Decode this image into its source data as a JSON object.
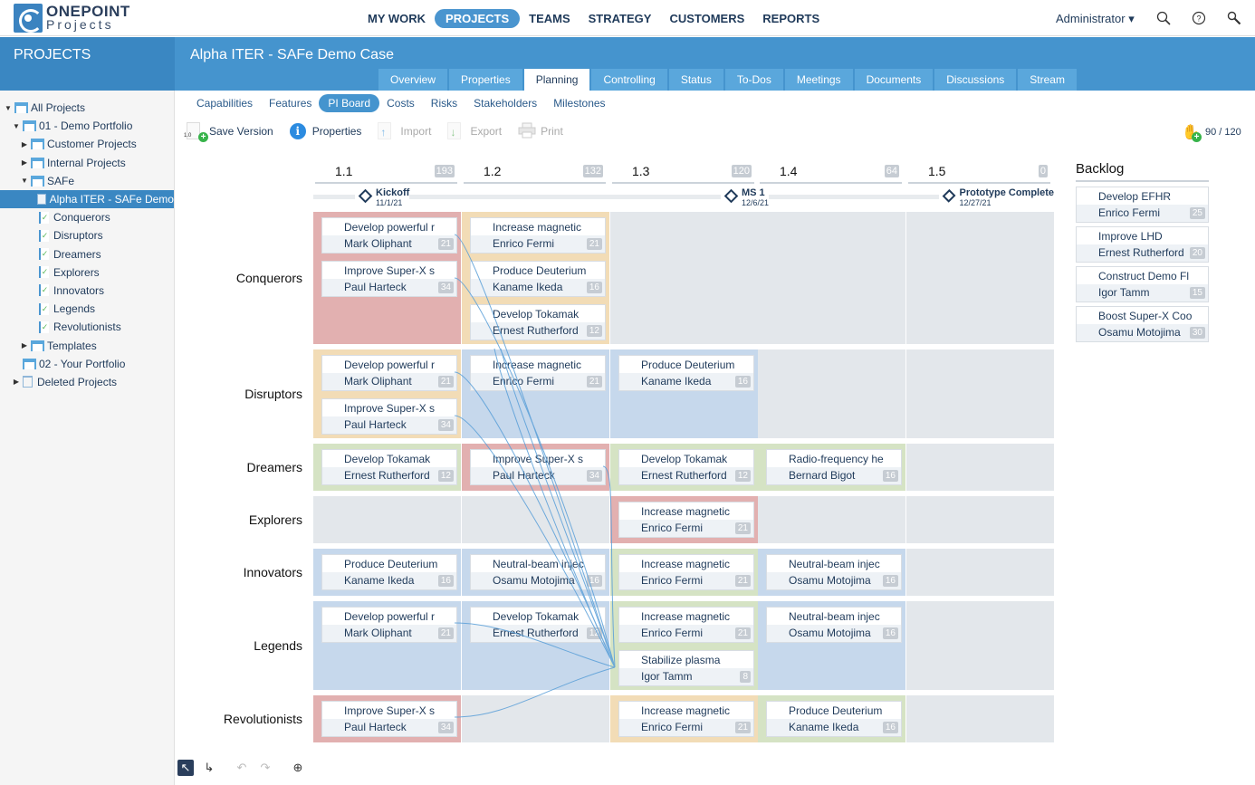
{
  "app": {
    "logo_top": "ONEPOINT",
    "logo_bottom": "Projects",
    "nav": [
      {
        "label": "MY WORK",
        "active": false
      },
      {
        "label": "PROJECTS",
        "active": true
      },
      {
        "label": "TEAMS",
        "active": false
      },
      {
        "label": "STRATEGY",
        "active": false
      },
      {
        "label": "CUSTOMERS",
        "active": false
      },
      {
        "label": "REPORTS",
        "active": false
      }
    ],
    "user": "Administrator ▾",
    "icons": {
      "search": "search-icon",
      "help": "help-icon",
      "tools": "wrench-icon"
    }
  },
  "sidebar": {
    "title": "PROJECTS",
    "tree": [
      {
        "label": "All Projects",
        "level": 0,
        "toggle": "▼",
        "icon": "folder"
      },
      {
        "label": "01 - Demo Portfolio",
        "level": 1,
        "toggle": "▼",
        "icon": "folder"
      },
      {
        "label": "Customer Projects",
        "level": 2,
        "toggle": "▶",
        "icon": "folder"
      },
      {
        "label": "Internal Projects",
        "level": 2,
        "toggle": "▶",
        "icon": "folder"
      },
      {
        "label": "SAFe",
        "level": 2,
        "toggle": "▼",
        "icon": "folder"
      },
      {
        "label": "Alpha ITER - SAFe Demo",
        "level": 3,
        "toggle": "",
        "icon": "project",
        "selected": true
      },
      {
        "label": "Conquerors",
        "level": 3,
        "toggle": "",
        "icon": "task"
      },
      {
        "label": "Disruptors",
        "level": 3,
        "toggle": "",
        "icon": "task"
      },
      {
        "label": "Dreamers",
        "level": 3,
        "toggle": "",
        "icon": "task"
      },
      {
        "label": "Explorers",
        "level": 3,
        "toggle": "",
        "icon": "task"
      },
      {
        "label": "Innovators",
        "level": 3,
        "toggle": "",
        "icon": "task"
      },
      {
        "label": "Legends",
        "level": 3,
        "toggle": "",
        "icon": "task"
      },
      {
        "label": "Revolutionists",
        "level": 3,
        "toggle": "",
        "icon": "task"
      },
      {
        "label": "Templates",
        "level": 2,
        "toggle": "▶",
        "icon": "folder"
      },
      {
        "label": "02 - Your Portfolio",
        "level": 1,
        "toggle": "",
        "icon": "folder"
      },
      {
        "label": "Deleted Projects",
        "level": 1,
        "toggle": "▶",
        "icon": "trash"
      }
    ]
  },
  "project": {
    "title": "Alpha ITER - SAFe Demo Case",
    "tabs": [
      {
        "label": "Overview"
      },
      {
        "label": "Properties"
      },
      {
        "label": "Planning",
        "active": true
      },
      {
        "label": "Controlling"
      },
      {
        "label": "Status"
      },
      {
        "label": "To-Dos"
      },
      {
        "label": "Meetings"
      },
      {
        "label": "Documents"
      },
      {
        "label": "Discussions"
      },
      {
        "label": "Stream"
      }
    ],
    "subtabs": [
      {
        "label": "Capabilities"
      },
      {
        "label": "Features"
      },
      {
        "label": "PI Board",
        "active": true
      },
      {
        "label": "Costs"
      },
      {
        "label": "Risks"
      },
      {
        "label": "Stakeholders"
      },
      {
        "label": "Milestones"
      }
    ],
    "toolbar": {
      "save_version": "Save Version",
      "properties": "Properties",
      "import": "Import",
      "export": "Export",
      "print": "Print",
      "version_badge": "1.0"
    },
    "capacity": "90 / 120"
  },
  "board": {
    "iterations": [
      {
        "label": "1.1",
        "count": "193"
      },
      {
        "label": "1.2",
        "count": "132"
      },
      {
        "label": "1.3",
        "count": "120"
      },
      {
        "label": "1.4",
        "count": "64"
      },
      {
        "label": "1.5",
        "count": "0"
      }
    ],
    "milestones": [
      {
        "name": "Kickoff",
        "date": "11/1/21"
      },
      {
        "name": "MS 1",
        "date": "12/6/21"
      },
      {
        "name": "Prototype Complete",
        "date": "12/27/21"
      }
    ],
    "teams": [
      {
        "name": "Conquerors",
        "cells": [
          {
            "color": "#e2b0b0",
            "cards": [
              {
                "title": "Develop powerful r",
                "owner": "Mark Oliphant",
                "points": "21"
              },
              {
                "title": "Improve Super-X s",
                "owner": "Paul Harteck",
                "points": "34"
              }
            ]
          },
          {
            "color": "#f2dcb6",
            "cards": [
              {
                "title": "Increase magnetic",
                "owner": "Enrico Fermi",
                "points": "21"
              },
              {
                "title": "Produce Deuterium",
                "owner": "Kaname Ikeda",
                "points": "16"
              },
              {
                "title": "Develop Tokamak",
                "owner": "Ernest Rutherford",
                "points": "12"
              }
            ]
          },
          {
            "color": "#e3e7eb",
            "cards": []
          },
          {
            "color": "#e3e7eb",
            "cards": []
          },
          {
            "color": "#e3e7eb",
            "cards": []
          }
        ]
      },
      {
        "name": "Disruptors",
        "cells": [
          {
            "color": "#f2dcb6",
            "cards": [
              {
                "title": "Develop powerful r",
                "owner": "Mark Oliphant",
                "points": "21"
              },
              {
                "title": "Improve Super-X s",
                "owner": "Paul Harteck",
                "points": "34"
              }
            ]
          },
          {
            "color": "#c6d8ec",
            "cards": [
              {
                "title": "Increase magnetic",
                "owner": "Enrico Fermi",
                "points": "21"
              }
            ]
          },
          {
            "color": "#c6d8ec",
            "cards": [
              {
                "title": "Produce Deuterium",
                "owner": "Kaname Ikeda",
                "points": "16"
              }
            ]
          },
          {
            "color": "#e3e7eb",
            "cards": []
          },
          {
            "color": "#e3e7eb",
            "cards": []
          }
        ]
      },
      {
        "name": "Dreamers",
        "cells": [
          {
            "color": "#d5e3c4",
            "cards": [
              {
                "title": "Develop Tokamak",
                "owner": "Ernest Rutherford",
                "points": "12"
              }
            ]
          },
          {
            "color": "#e2b0b0",
            "cards": [
              {
                "title": "Improve Super-X s",
                "owner": "Paul Harteck",
                "points": "34"
              }
            ]
          },
          {
            "color": "#d5e3c4",
            "cards": [
              {
                "title": "Develop Tokamak",
                "owner": "Ernest Rutherford",
                "points": "12"
              }
            ]
          },
          {
            "color": "#d5e3c4",
            "cards": [
              {
                "title": "Radio-frequency he",
                "owner": "Bernard Bigot",
                "points": "16"
              }
            ]
          },
          {
            "color": "#e3e7eb",
            "cards": []
          }
        ]
      },
      {
        "name": "Explorers",
        "cells": [
          {
            "color": "#e3e7eb",
            "cards": []
          },
          {
            "color": "#e3e7eb",
            "cards": []
          },
          {
            "color": "#e2b0b0",
            "cards": [
              {
                "title": "Increase magnetic",
                "owner": "Enrico Fermi",
                "points": "21"
              }
            ]
          },
          {
            "color": "#e3e7eb",
            "cards": []
          },
          {
            "color": "#e3e7eb",
            "cards": []
          }
        ]
      },
      {
        "name": "Innovators",
        "cells": [
          {
            "color": "#c6d8ec",
            "cards": [
              {
                "title": "Produce Deuterium",
                "owner": "Kaname Ikeda",
                "points": "16"
              }
            ]
          },
          {
            "color": "#c6d8ec",
            "cards": [
              {
                "title": "Neutral-beam injec",
                "owner": "Osamu Motojima",
                "points": "16"
              }
            ]
          },
          {
            "color": "#d5e3c4",
            "cards": [
              {
                "title": "Increase magnetic",
                "owner": "Enrico Fermi",
                "points": "21"
              }
            ]
          },
          {
            "color": "#c6d8ec",
            "cards": [
              {
                "title": "Neutral-beam injec",
                "owner": "Osamu Motojima",
                "points": "16"
              }
            ]
          },
          {
            "color": "#e3e7eb",
            "cards": []
          }
        ]
      },
      {
        "name": "Legends",
        "cells": [
          {
            "color": "#c6d8ec",
            "cards": [
              {
                "title": "Develop powerful r",
                "owner": "Mark Oliphant",
                "points": "21"
              }
            ]
          },
          {
            "color": "#c6d8ec",
            "cards": [
              {
                "title": "Develop Tokamak",
                "owner": "Ernest Rutherford",
                "points": "12"
              }
            ]
          },
          {
            "color": "#d5e3c4",
            "cards": [
              {
                "title": "Increase magnetic",
                "owner": "Enrico Fermi",
                "points": "21"
              },
              {
                "title": "Stabilize plasma",
                "owner": "Igor Tamm",
                "points": "8"
              }
            ]
          },
          {
            "color": "#c6d8ec",
            "cards": [
              {
                "title": "Neutral-beam injec",
                "owner": "Osamu Motojima",
                "points": "16"
              }
            ]
          },
          {
            "color": "#e3e7eb",
            "cards": []
          }
        ]
      },
      {
        "name": "Revolutionists",
        "cells": [
          {
            "color": "#e2b0b0",
            "cards": [
              {
                "title": "Improve Super-X s",
                "owner": "Paul Harteck",
                "points": "34"
              }
            ]
          },
          {
            "color": "#e3e7eb",
            "cards": []
          },
          {
            "color": "#f2dcb6",
            "cards": [
              {
                "title": "Increase magnetic",
                "owner": "Enrico Fermi",
                "points": "21"
              }
            ]
          },
          {
            "color": "#d5e3c4",
            "cards": [
              {
                "title": "Produce Deuterium",
                "owner": "Kaname Ikeda",
                "points": "16"
              }
            ]
          },
          {
            "color": "#e3e7eb",
            "cards": []
          }
        ]
      }
    ]
  },
  "backlog": {
    "title": "Backlog",
    "cards": [
      {
        "title": "Develop EFHR",
        "owner": "Enrico Fermi",
        "points": "25"
      },
      {
        "title": "Improve LHD",
        "owner": "Ernest Rutherford",
        "points": "20"
      },
      {
        "title": "Construct Demo Fl",
        "owner": "Igor Tamm",
        "points": "15"
      },
      {
        "title": "Boost Super-X Coo",
        "owner": "Osamu Motojima",
        "points": "30"
      }
    ]
  },
  "bottom_tools": [
    {
      "name": "select-tool-icon",
      "glyph": "↖",
      "state": "selected"
    },
    {
      "name": "connect-tool-icon",
      "glyph": "↳",
      "state": "normal"
    },
    {
      "name": "undo-icon",
      "glyph": "↶",
      "state": "disabled"
    },
    {
      "name": "redo-icon",
      "glyph": "↷",
      "state": "disabled"
    },
    {
      "name": "assign-icon",
      "glyph": "⊕",
      "state": "normal"
    }
  ]
}
